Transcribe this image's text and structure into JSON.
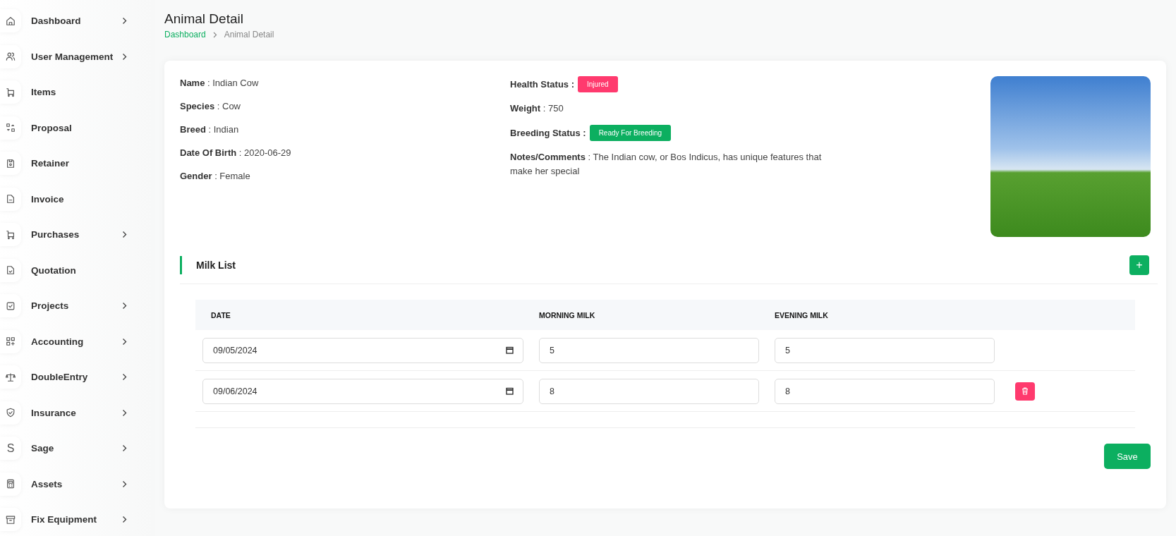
{
  "sidebar": {
    "items": [
      {
        "label": "Dashboard",
        "has_submenu": true
      },
      {
        "label": "User Management",
        "has_submenu": true
      },
      {
        "label": "Items",
        "has_submenu": false
      },
      {
        "label": "Proposal",
        "has_submenu": false
      },
      {
        "label": "Retainer",
        "has_submenu": false
      },
      {
        "label": "Invoice",
        "has_submenu": false
      },
      {
        "label": "Purchases",
        "has_submenu": true
      },
      {
        "label": "Quotation",
        "has_submenu": false
      },
      {
        "label": "Projects",
        "has_submenu": true
      },
      {
        "label": "Accounting",
        "has_submenu": true
      },
      {
        "label": "DoubleEntry",
        "has_submenu": true
      },
      {
        "label": "Insurance",
        "has_submenu": true
      },
      {
        "label": "Sage",
        "has_submenu": true,
        "icon_text": "S"
      },
      {
        "label": "Assets",
        "has_submenu": true
      },
      {
        "label": "Fix Equipment",
        "has_submenu": true
      }
    ]
  },
  "page_title": "Animal Detail",
  "breadcrumb": [
    {
      "label": "Dashboard",
      "link": true
    },
    {
      "label": "Animal Detail",
      "link": false
    }
  ],
  "details_left": [
    {
      "text": "**Name** : Indian Cow"
    },
    {
      "text": "**Species** : Cow"
    },
    {
      "text": "**Breed** : Indian"
    },
    {
      "text": "**Date Of Birth** : 2020-06-29"
    },
    {
      "text": "**Gender** : Female"
    }
  ],
  "details_right": [
    {
      "kind": "badge",
      "label": "Health Status :",
      "value": "Injured",
      "color": "#ff3a6e"
    },
    {
      "kind": "text",
      "text": "**Weight** : 750"
    },
    {
      "kind": "badge",
      "label": "Breeding Status :",
      "value": "Ready For Breeding",
      "color": "#0caf60"
    },
    {
      "kind": "text",
      "text": "**Notes/Comments** : The Indian cow, or Bos Indicus, has unique features that make her special"
    }
  ],
  "milk_list": {
    "title": "Milk List",
    "add_button": "+",
    "columns": [
      "DATE",
      "MORNING MILK",
      "EVENING MILK"
    ],
    "rows": [
      {
        "date": "09/05/2024",
        "morning": "5",
        "evening": "5",
        "deletable": false
      },
      {
        "date": "09/06/2024",
        "morning": "8",
        "evening": "8",
        "deletable": true
      }
    ]
  },
  "save_button": "Save"
}
